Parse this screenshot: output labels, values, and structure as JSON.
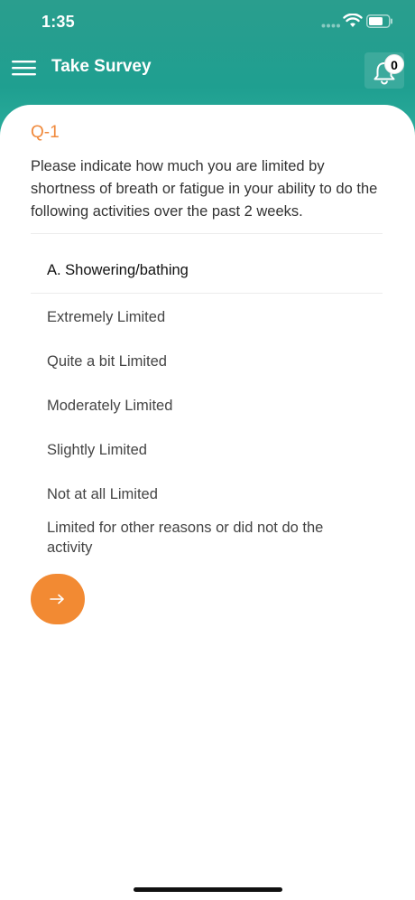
{
  "status_bar": {
    "time": "1:35"
  },
  "nav": {
    "title": "Take Survey",
    "notification_count": "0",
    "icons": [
      "hamburger-menu-icon",
      "bell-icon",
      "wifi-icon",
      "battery-icon",
      "cellular-signal-icon"
    ]
  },
  "question": {
    "id": "Q-1",
    "text": "Please indicate how much you are limited by shortness of breath or fatigue in your ability to do the following activities over the past 2 weeks.",
    "sub_question": "A. Showering/bathing",
    "options": [
      "Extremely Limited",
      "Quite a bit Limited",
      "Moderately Limited",
      "Slightly Limited",
      "Not at all Limited",
      "Limited for other reasons or did not do the activity"
    ]
  },
  "actions": {
    "next_icon": "arrow-right-icon"
  },
  "colors": {
    "header_teal": "#2a9e8e",
    "accent_orange": "#f28a33",
    "question_id_orange": "#f0893b"
  }
}
